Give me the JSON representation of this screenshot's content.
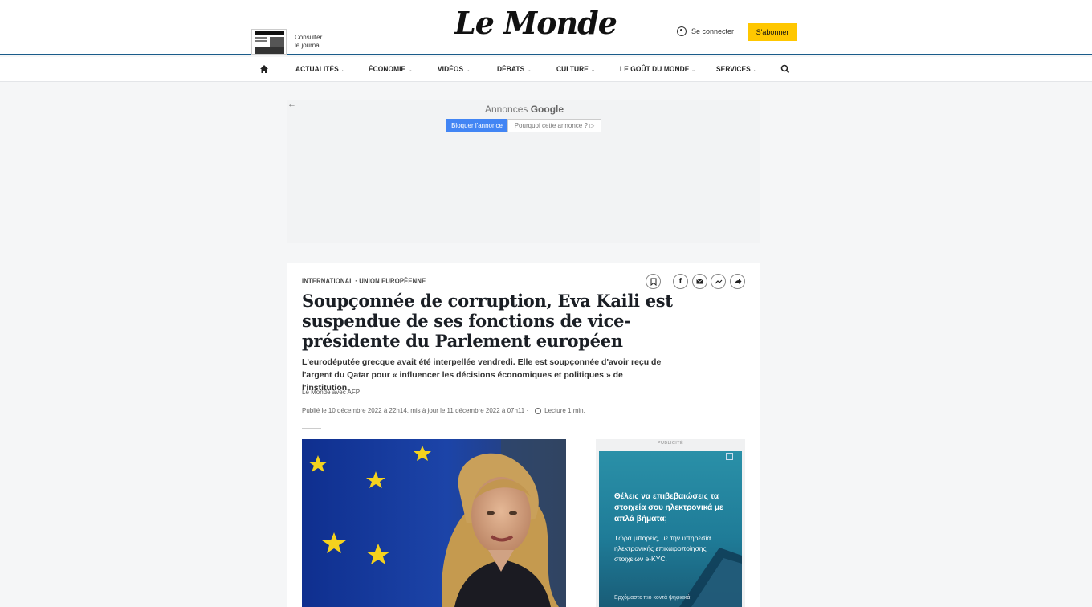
{
  "header": {
    "journal_label_1": "Consulter",
    "journal_label_2": "le journal",
    "logo": "Le Monde",
    "connect_label": "Se connecter",
    "subscribe_label": "S'abonner"
  },
  "nav": {
    "items": [
      {
        "label": "ACTUALITÉS"
      },
      {
        "label": "ÉCONOMIE"
      },
      {
        "label": "VIDÉOS"
      },
      {
        "label": "DÉBATS"
      },
      {
        "label": "CULTURE"
      },
      {
        "label": "LE GOÛT DU MONDE"
      },
      {
        "label": "SERVICES"
      }
    ]
  },
  "ad_top": {
    "back_arrow": "←",
    "title_prefix": "Annonces ",
    "title_brand": "Google",
    "block_label": "Bloquer l'annonce",
    "why_label": "Pourquoi cette annonce ? ▷"
  },
  "article": {
    "kicker": "INTERNATIONAL · UNION EUROPÉENNE",
    "headline": "Soupçonnée de corruption, Eva Kaili est suspendue de ses fonctions de vice-présidente du Parlement européen",
    "description": "L'eurodéputée grecque avait été interpellée vendredi. Elle est soupçonnée d'avoir reçu de l'argent du Qatar pour « influencer les décisions économiques et politiques » de l'institution.",
    "byline": "Le Monde avec AFP",
    "published": "Publié le 10 décembre 2022 à 22h14, mis à jour le 11 décembre 2022 à 07h11 ·",
    "reading_time": "Lecture 1 min.",
    "share_icons": [
      "bookmark-icon",
      "facebook-icon",
      "email-icon",
      "messenger-icon",
      "share-icon"
    ]
  },
  "side_ad": {
    "label": "PUBLICITÉ",
    "text_1": "Θέλεις να επιβεβαιώσεις τα στοιχεία σου ηλεκτρονικά με απλά βήματα;",
    "text_2": "Τώρα μπορείς, με την υπηρεσία ηλεκτρονικής επικαιροποίησης στοιχείων e-KYC.",
    "text_3": "Ερχόμαστε πιο κοντά ψηφιακά"
  },
  "colors": {
    "accent": "#1a5c8a",
    "subscribe": "#ffc700",
    "google_blue": "#4285f4",
    "eu_blue": "#15399a",
    "eu_star": "#f4d21e"
  }
}
